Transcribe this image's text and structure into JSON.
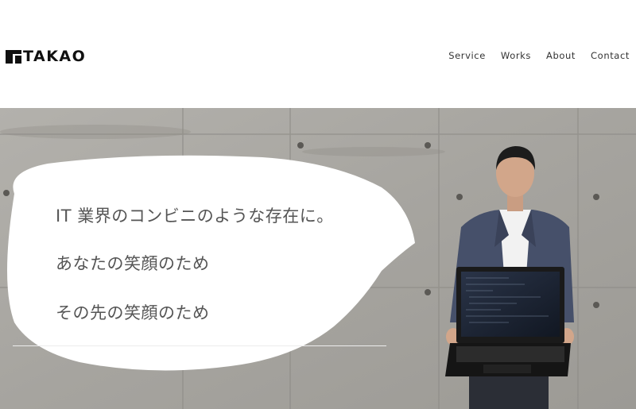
{
  "header": {
    "logo_text": "TAKAO",
    "nav": [
      {
        "label": "Service"
      },
      {
        "label": "Works"
      },
      {
        "label": "About"
      },
      {
        "label": "Contact"
      }
    ]
  },
  "hero": {
    "lines": [
      "IT 業界のコンビニのような存在に。",
      "あなたの笑顔のため",
      "その先の笑顔のため"
    ]
  },
  "colors": {
    "text": "#111111",
    "nav_text": "#333333",
    "hero_text": "#555555",
    "concrete": "#a7a5a0"
  }
}
